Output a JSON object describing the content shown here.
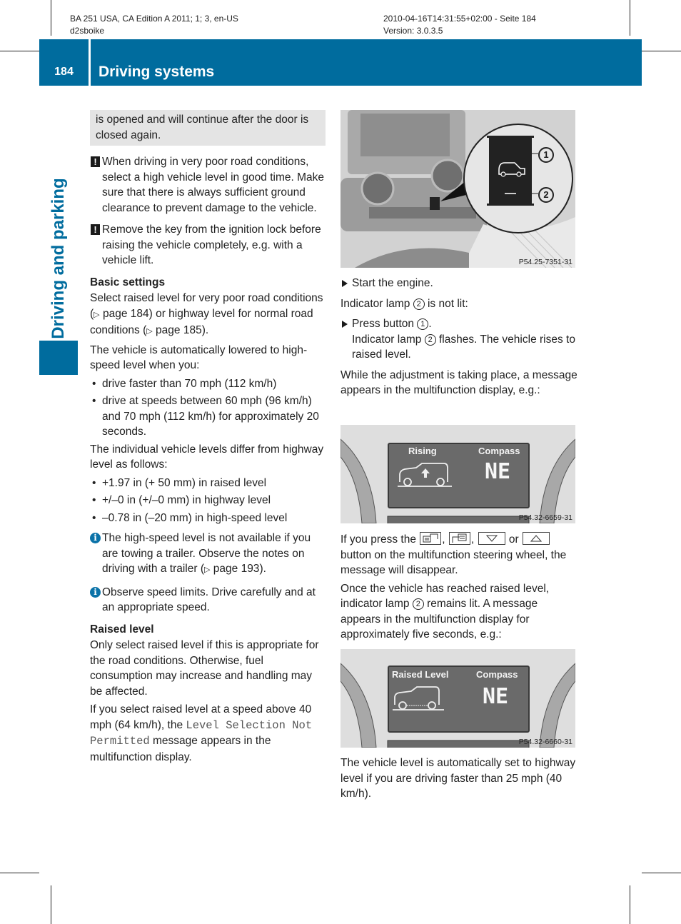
{
  "print_meta": {
    "left_line1": "BA 251 USA, CA Edition A 2011; 1; 3, en-US",
    "left_line2": "d2sboike",
    "right_line1": "2010-04-16T14:31:55+02:00 - Seite 184",
    "right_line2": "Version: 3.0.3.5"
  },
  "header": {
    "page_number": "184",
    "section_title": "Driving systems"
  },
  "side_tab": {
    "label": "Driving and parking"
  },
  "colors": {
    "brand_blue": "#006c9e",
    "info_blue": "#0a72a8",
    "note_grey": "#e4e4e4"
  },
  "left_column": {
    "continuation_box": "is opened and will continue after the door is closed again.",
    "warnings": [
      "When driving in very poor road conditions, select a high vehicle level in good time. Make sure that there is always sufficient ground clearance to prevent damage to the vehicle.",
      "Remove the key from the ignition lock before raising the vehicle completely, e.g. with a vehicle lift."
    ],
    "warning_symbol": "!",
    "basic_settings": {
      "heading": "Basic settings",
      "para1_a": "Select raised level for very poor road conditions (",
      "para1_ref1": "page 184",
      "para1_b": ") or highway level for normal road conditions (",
      "para1_ref2": "page 185",
      "para1_c": ").",
      "para2": "The vehicle is automatically lowered to high-speed level when you:",
      "bullets": [
        "drive faster than 70 mph (112 km/h)",
        "drive at speeds between 60 mph (96 km/h) and 70 mph (112 km/h) for approximately 20 seconds."
      ],
      "para3": "The individual vehicle levels differ from highway level as follows:",
      "levels": [
        "+1.97 in (+ 50 mm) in raised level",
        "+/–0 in (+/–0 mm) in highway level",
        "–0.78 in (–20 mm) in high-speed level"
      ],
      "info_symbol": "i",
      "info1_a": "The high-speed level is not available if you are towing a trailer. Observe the notes on driving with a trailer (",
      "info1_ref": "page 193",
      "info1_b": ").",
      "info2": "Observe speed limits. Drive carefully and at an appropriate speed."
    },
    "raised_level": {
      "heading": "Raised level",
      "para1": "Only select raised level if this is appropriate for the road conditions. Otherwise, fuel consumption may increase and handling may be affected.",
      "para2_a": "If you select raised level at a speed above 40 mph (64 km/h), the ",
      "para2_mono": "Level Selection Not Permitted",
      "para2_b": " message appears in the multifunction display."
    }
  },
  "right_column": {
    "figure1": {
      "label": "P54.25-7351-31",
      "callout1": "1",
      "callout2": "2",
      "icon": "vehicle-level-button-icon"
    },
    "step1": "Start the engine.",
    "condition_a": "Indicator lamp ",
    "condition_num": "2",
    "condition_b": " is not lit:",
    "step2_a": "Press button ",
    "step2_num": "1",
    "step2_b": ".",
    "step2_result_a": "Indicator lamp ",
    "step2_result_num": "2",
    "step2_result_b": " flashes. The vehicle rises to raised level.",
    "para_adjust": "While the adjustment is taking place, a message appears in the multifunction display, e.g.:",
    "figure2": {
      "label": "P54.32-6659-31",
      "status": "Rising",
      "compass_label": "Compass",
      "compass_value": "NE"
    },
    "para_press_a": "If you press the ",
    "para_press_sep1": ", ",
    "para_press_sep2": ", ",
    "para_press_or": " or ",
    "para_press_b": " button on the multifunction steering wheel, the message will disappear.",
    "press_button_icons": [
      "display-back-button-icon",
      "display-forward-button-icon",
      "down-arrow-button-icon",
      "up-arrow-button-icon"
    ],
    "para_reached_a": "Once the vehicle has reached raised level, indicator lamp ",
    "para_reached_num": "2",
    "para_reached_b": " remains lit. A message appears in the multifunction display for approximately five seconds, e.g.:",
    "figure3": {
      "label": "P54.32-6660-31",
      "status": "Raised Level",
      "compass_label": "Compass",
      "compass_value": "NE"
    },
    "para_auto": "The vehicle level is automatically set to highway level if you are driving faster than 25 mph (40 km/h)."
  }
}
